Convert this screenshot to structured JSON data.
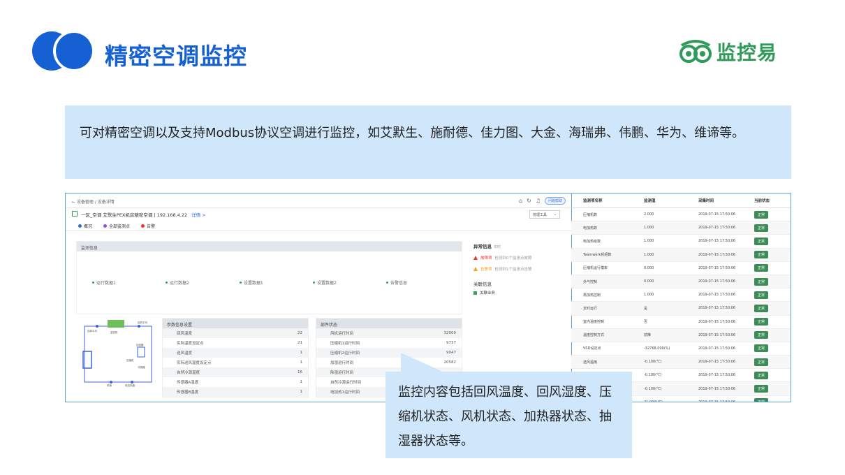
{
  "header": {
    "title": "精密空调监控",
    "brand": "监控易",
    "colors": {
      "primary_blue": "#1560d3",
      "brand_green": "#2e9b58"
    }
  },
  "description": "可对精密空调以及支持Modbus协议空调进行监控，如艾默生、施耐德、佳力图、大金、海瑞弗、伟鹏、华为、维谛等。",
  "callout": "监控内容包括回风温度、回风湿度、压缩机状态、风机状态、加热器状态、抽湿器状态等。",
  "screenshot": {
    "breadcrumb": "← 设备管理 / 设备详情",
    "help": "问题帮助",
    "device_line": "一区_空调  艾默生PEX机房精密空调 | 192.168.4.22",
    "details_link": "详情 >",
    "manage_tool": "管理工具",
    "tabs": [
      "概况",
      "全部监测点",
      "告警"
    ],
    "monitor_title": "监测信息",
    "monitor_items": [
      "运行数据1",
      "运行数据2",
      "设置数据1",
      "设置数据2",
      "告警信息"
    ],
    "alarm": {
      "title": "异常信息",
      "realtime": "实时",
      "items": [
        {
          "label": "故障项",
          "text": "检测到0个监测点故障",
          "color": "#e33"
        },
        {
          "label": "告警项",
          "text": "检测到1个监测点告警",
          "color": "#f0a020"
        }
      ],
      "related_title": "关联信息",
      "related_item": "关联业务"
    },
    "params_table": {
      "title": "参数信息设置",
      "rows": [
        [
          "回风温度",
          "22"
        ],
        [
          "实际温度设定点",
          "21"
        ],
        [
          "送风温度",
          "1"
        ],
        [
          "实际送风温度设定点",
          "1"
        ],
        [
          "自然冷源温度",
          "16"
        ],
        [
          "传感器A温度",
          "1"
        ],
        [
          "传感器B温度",
          "1"
        ]
      ]
    },
    "run_table": {
      "title": "部件状态",
      "rows": [
        [
          "风机运行时间",
          "32000"
        ],
        [
          "压缩机1运行时间",
          "9737"
        ],
        [
          "压缩机2运行时间",
          "9047"
        ],
        [
          "加湿运行时间",
          "20582"
        ],
        [
          "除湿运行时间",
          ""
        ],
        [
          "自然冷源运行时间",
          ""
        ],
        [
          "电加热1运行时间",
          ""
        ]
      ]
    },
    "diagram_labels": [
      "回风平均",
      "温控柜",
      "回风平均",
      "加湿器",
      "压缩机",
      "冷凝器",
      "风扇",
      "电加热器"
    ],
    "right_table": {
      "headers": [
        "监测项名称",
        "监测值",
        "采集时间",
        "当前状态"
      ],
      "rows": [
        [
          "压缩机数",
          "2.000",
          "2019-07-15 17:50:06",
          "正常"
        ],
        [
          "电加热数",
          "1.000",
          "2019-07-15 17:50:06",
          "正常"
        ],
        [
          "电加热级数",
          "1.000",
          "2019-07-15 17:50:06",
          "正常"
        ],
        [
          "Teamwork机组数",
          "1.000",
          "2019-07-15 17:50:06",
          "正常"
        ],
        [
          "压缩机运行模率",
          "0.000",
          "2019-07-15 17:50:06",
          "正常"
        ],
        [
          "外气控制",
          "0.000",
          "2019-07-15 17:50:06",
          "正常"
        ],
        [
          "再加热控制",
          "1.000",
          "2019-07-15 17:50:06",
          "正常"
        ],
        [
          "定时运行",
          "是",
          "2019-07-15 17:50:06",
          "正常"
        ],
        [
          "室内温度控制",
          "否",
          "2019-07-15 17:50:06",
          "正常"
        ],
        [
          "温度控制方式",
          "前推",
          "2019-07-15 17:50:06",
          "正常"
        ],
        [
          "VSD设定点",
          "-32768.000(%)",
          "2019-07-15 17:50:06",
          "正常"
        ],
        [
          "送风温用",
          "-0.100(℃)",
          "2019-07-15 17:50:06",
          "正常"
        ],
        [
          "室内机防然冷源温度",
          "-0.100(℃)",
          "2019-07-15 17:50:06",
          "正常"
        ],
        [
          "",
          "-0.100(℃)",
          "2019-07-15 17:50:06",
          "正常"
        ],
        [
          "",
          "21.000(℃)",
          "2019-07-15 17:50:06",
          "正常"
        ]
      ]
    }
  }
}
